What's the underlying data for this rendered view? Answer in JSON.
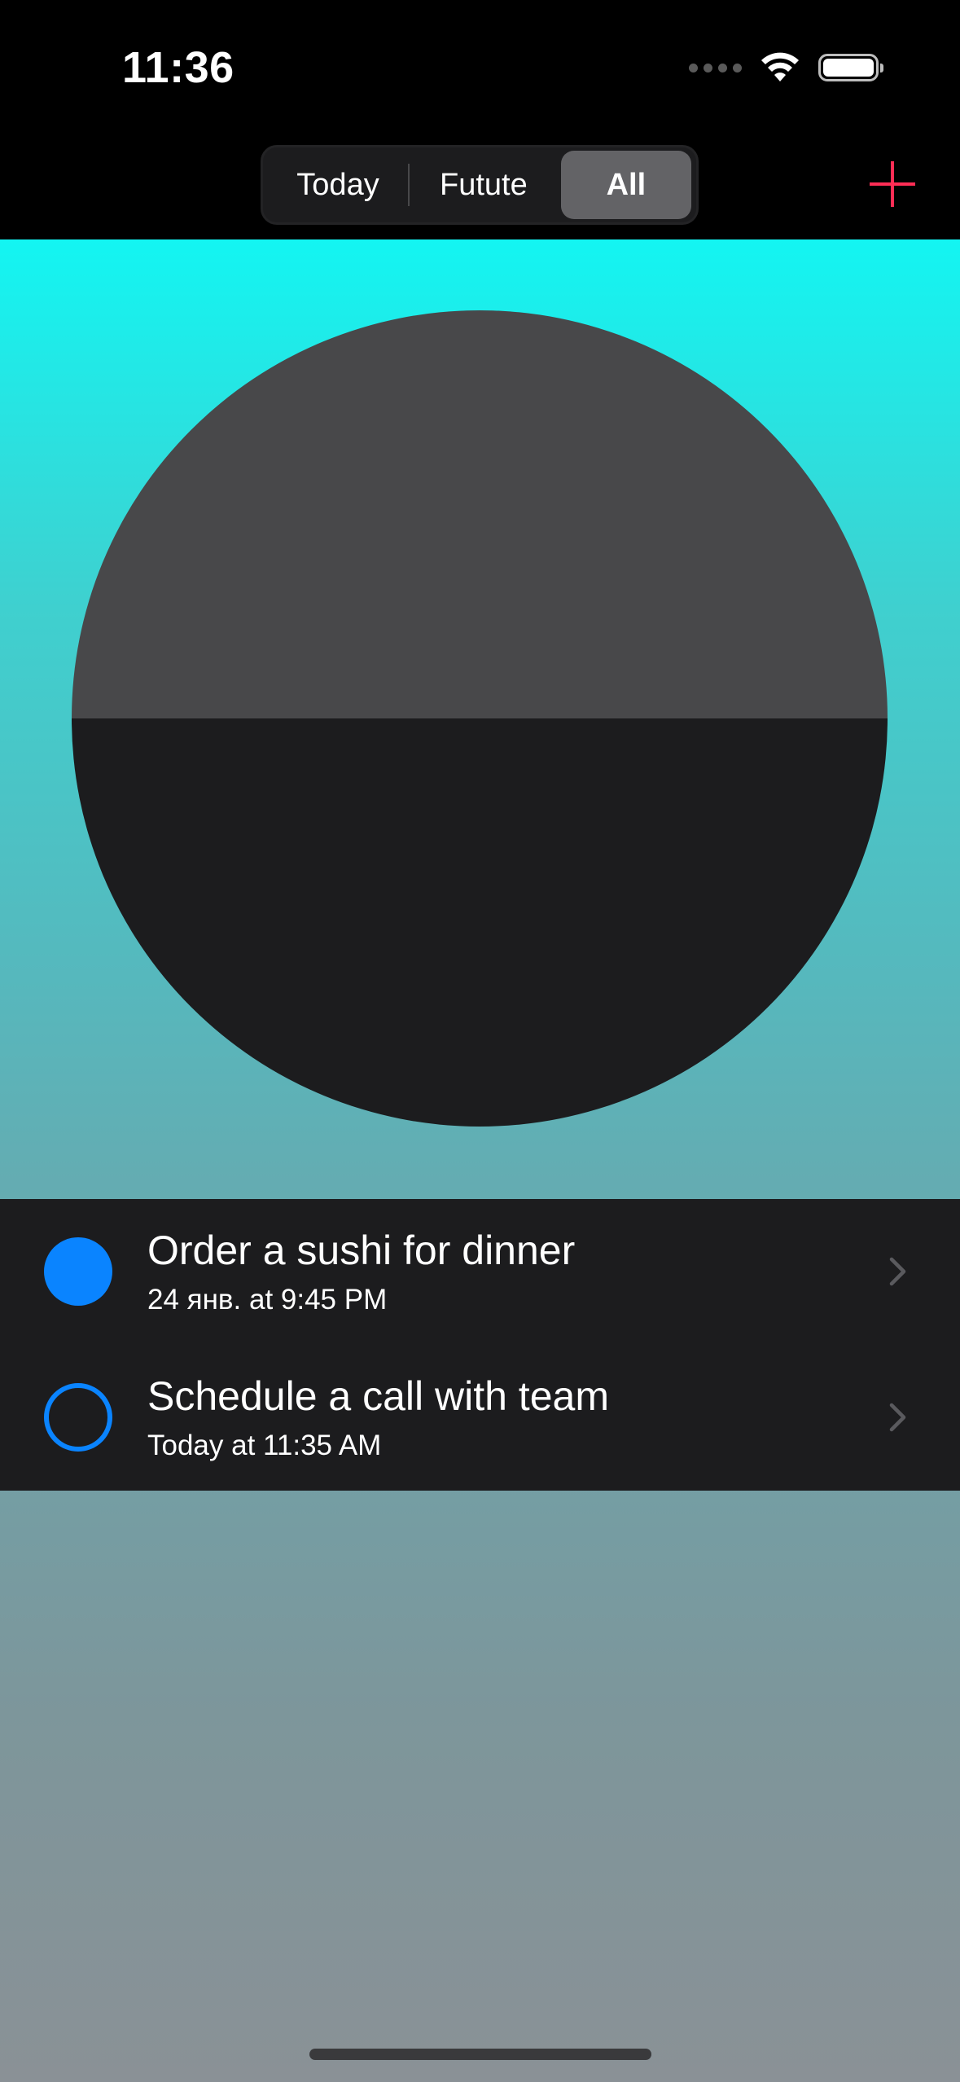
{
  "status_bar": {
    "time": "11:36"
  },
  "segmented_control": {
    "options": [
      "Today",
      "Futute",
      "All"
    ],
    "selected": "All"
  },
  "colors": {
    "accent_add": "#ff2d55",
    "checkbox_blue": "#0a84ff",
    "pie_upper": "#48484a",
    "pie_lower": "#1c1c1e"
  },
  "tasks": [
    {
      "title": "Order a sushi for dinner",
      "subtitle": "24 янв. at 9:45 PM",
      "completed": true
    },
    {
      "title": "Schedule a call with team",
      "subtitle": "Today at 11:35 AM",
      "completed": false
    }
  ],
  "icons": {
    "add": "plus-icon",
    "row_disclosure": "chevron-right-icon",
    "wifi": "wifi-icon",
    "battery": "battery-icon"
  }
}
